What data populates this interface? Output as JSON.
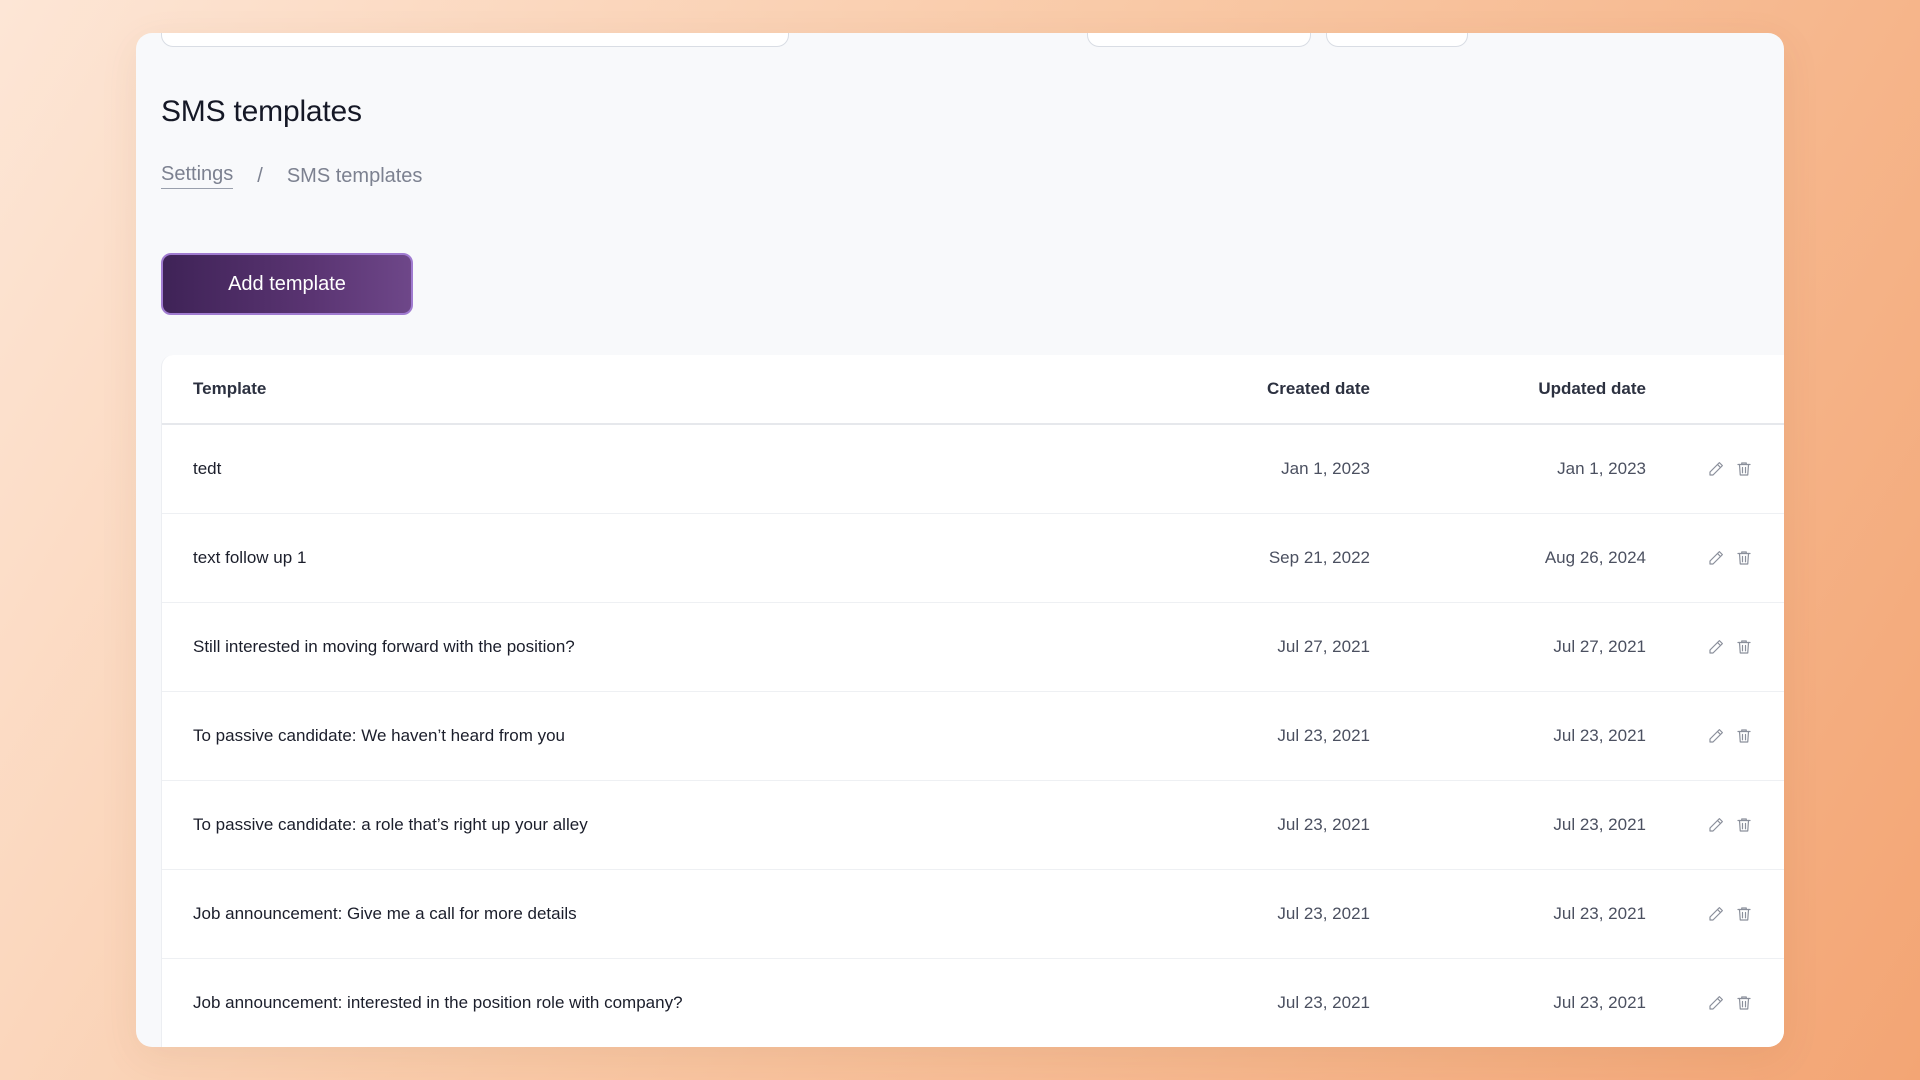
{
  "header": {
    "title": "SMS templates"
  },
  "breadcrumb": {
    "parent": "Settings",
    "separator": "/",
    "current": "SMS templates"
  },
  "actions": {
    "add_label": "Add template"
  },
  "table": {
    "columns": {
      "template": "Template",
      "created": "Created date",
      "updated": "Updated date"
    },
    "rows": [
      {
        "name": "tedt",
        "created": "Jan 1, 2023",
        "updated": "Jan 1, 2023"
      },
      {
        "name": "text follow up 1",
        "created": "Sep 21, 2022",
        "updated": "Aug 26, 2024"
      },
      {
        "name": "Still interested in moving forward with the position?",
        "created": "Jul 27, 2021",
        "updated": "Jul 27, 2021"
      },
      {
        "name": "To passive candidate: We haven’t heard from you",
        "created": "Jul 23, 2021",
        "updated": "Jul 23, 2021"
      },
      {
        "name": "To passive candidate: a role that’s right up your alley",
        "created": "Jul 23, 2021",
        "updated": "Jul 23, 2021"
      },
      {
        "name": "Job announcement: Give me a call for more details",
        "created": "Jul 23, 2021",
        "updated": "Jul 23, 2021"
      },
      {
        "name": "Job announcement: interested in the position role with company?",
        "created": "Jul 23, 2021",
        "updated": "Jul 23, 2021"
      }
    ],
    "row_icons": [
      "pencil-icon",
      "trash-icon"
    ]
  },
  "colors": {
    "accent_button": "#4a2a63",
    "accent_border": "#a07bd0",
    "background_start": "#fde6d6",
    "background_end": "#f3a574"
  }
}
